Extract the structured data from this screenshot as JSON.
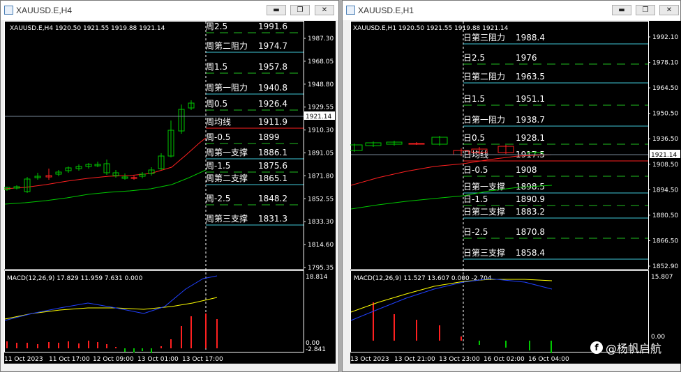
{
  "windows": [
    {
      "title": "XAUUSD.E,H4",
      "header": "XAUUSD.E,H4  1920.50 1921.55 1919.88 1921.14",
      "price_labels": [
        "1987.30",
        "1968.05",
        "1948.80",
        "1929.55",
        "1910.30",
        "1891.05",
        "1871.80",
        "1852.55",
        "1833.30",
        "1814.60",
        "1795.35"
      ],
      "current_price": "1921.14",
      "levels": [
        {
          "name": "周2.5",
          "value": "1991.6"
        },
        {
          "name": "周第二阻力",
          "value": "1974.7"
        },
        {
          "name": "周1.5",
          "value": "1957.8"
        },
        {
          "name": "周第一阻力",
          "value": "1940.8"
        },
        {
          "name": "周0.5",
          "value": "1926.4"
        },
        {
          "name": "周均线",
          "value": "1911.9"
        },
        {
          "name": "周-0.5",
          "value": "1899"
        },
        {
          "name": "周第一支撑",
          "value": "1886.1"
        },
        {
          "name": "周-1.5",
          "value": "1875.6"
        },
        {
          "name": "周第二支撑",
          "value": "1865.1"
        },
        {
          "name": "周-2.5",
          "value": "1848.2"
        },
        {
          "name": "周第三支撑",
          "value": "1831.3"
        }
      ],
      "macd_label": "MACD(12,26,9) 17.829 11.959 7.631 0.000",
      "macd_scale": [
        "18.814",
        "0.00",
        "-2.841"
      ],
      "time_labels": [
        "11 Oct 2023",
        "11 Oct 17:00",
        "12 Oct 09:00",
        "13 Oct 01:00",
        "13 Oct 17:00"
      ]
    },
    {
      "title": "XAUUSD.E,H1",
      "header": "XAUUSD.E,H1  1920.50 1921.55 1919.88 1921.14",
      "price_labels": [
        "1992.10",
        "1978.10",
        "1964.50",
        "1950.50",
        "1936.50",
        "1908.50",
        "1894.50",
        "1880.50",
        "1866.50",
        "1852.90"
      ],
      "current_price": "1921.14",
      "levels": [
        {
          "name": "日第三阻力",
          "value": "1988.4"
        },
        {
          "name": "日2.5",
          "value": "1976"
        },
        {
          "name": "日第二阻力",
          "value": "1963.5"
        },
        {
          "name": "日1.5",
          "value": "1951.1"
        },
        {
          "name": "日第一阻力",
          "value": "1938.7"
        },
        {
          "name": "日0.5",
          "value": "1928.1"
        },
        {
          "name": "日均线",
          "value": "1917.5"
        },
        {
          "name": "日-0.5",
          "value": "1908"
        },
        {
          "name": "日第一支撑",
          "value": "1898.5"
        },
        {
          "name": "日-1.5",
          "value": "1890.9"
        },
        {
          "name": "日第二支撑",
          "value": "1883.2"
        },
        {
          "name": "日-2.5",
          "value": "1870.8"
        },
        {
          "name": "日第三支撑",
          "value": "1858.4"
        }
      ],
      "macd_label": "MACD(12,26,9) 11.527 13.607 0.000 -2.704",
      "macd_scale": [
        "15.807",
        "0.00"
      ],
      "time_labels": [
        "13 Oct 2023",
        "13 Oct 21:00",
        "13 Oct 23:00",
        "16 Oct 02:00",
        "16 Oct 04:00"
      ]
    }
  ],
  "watermark": "@杨帆启航",
  "colors": {
    "bull": "#00c800",
    "bear": "#ff2020",
    "ma_red": "#ff2020",
    "ma_green": "#00c800",
    "level_line": "#40c8d8",
    "grid": "#ffffff",
    "macd_signal": "#ffff00",
    "macd_main": "#2040ff"
  }
}
